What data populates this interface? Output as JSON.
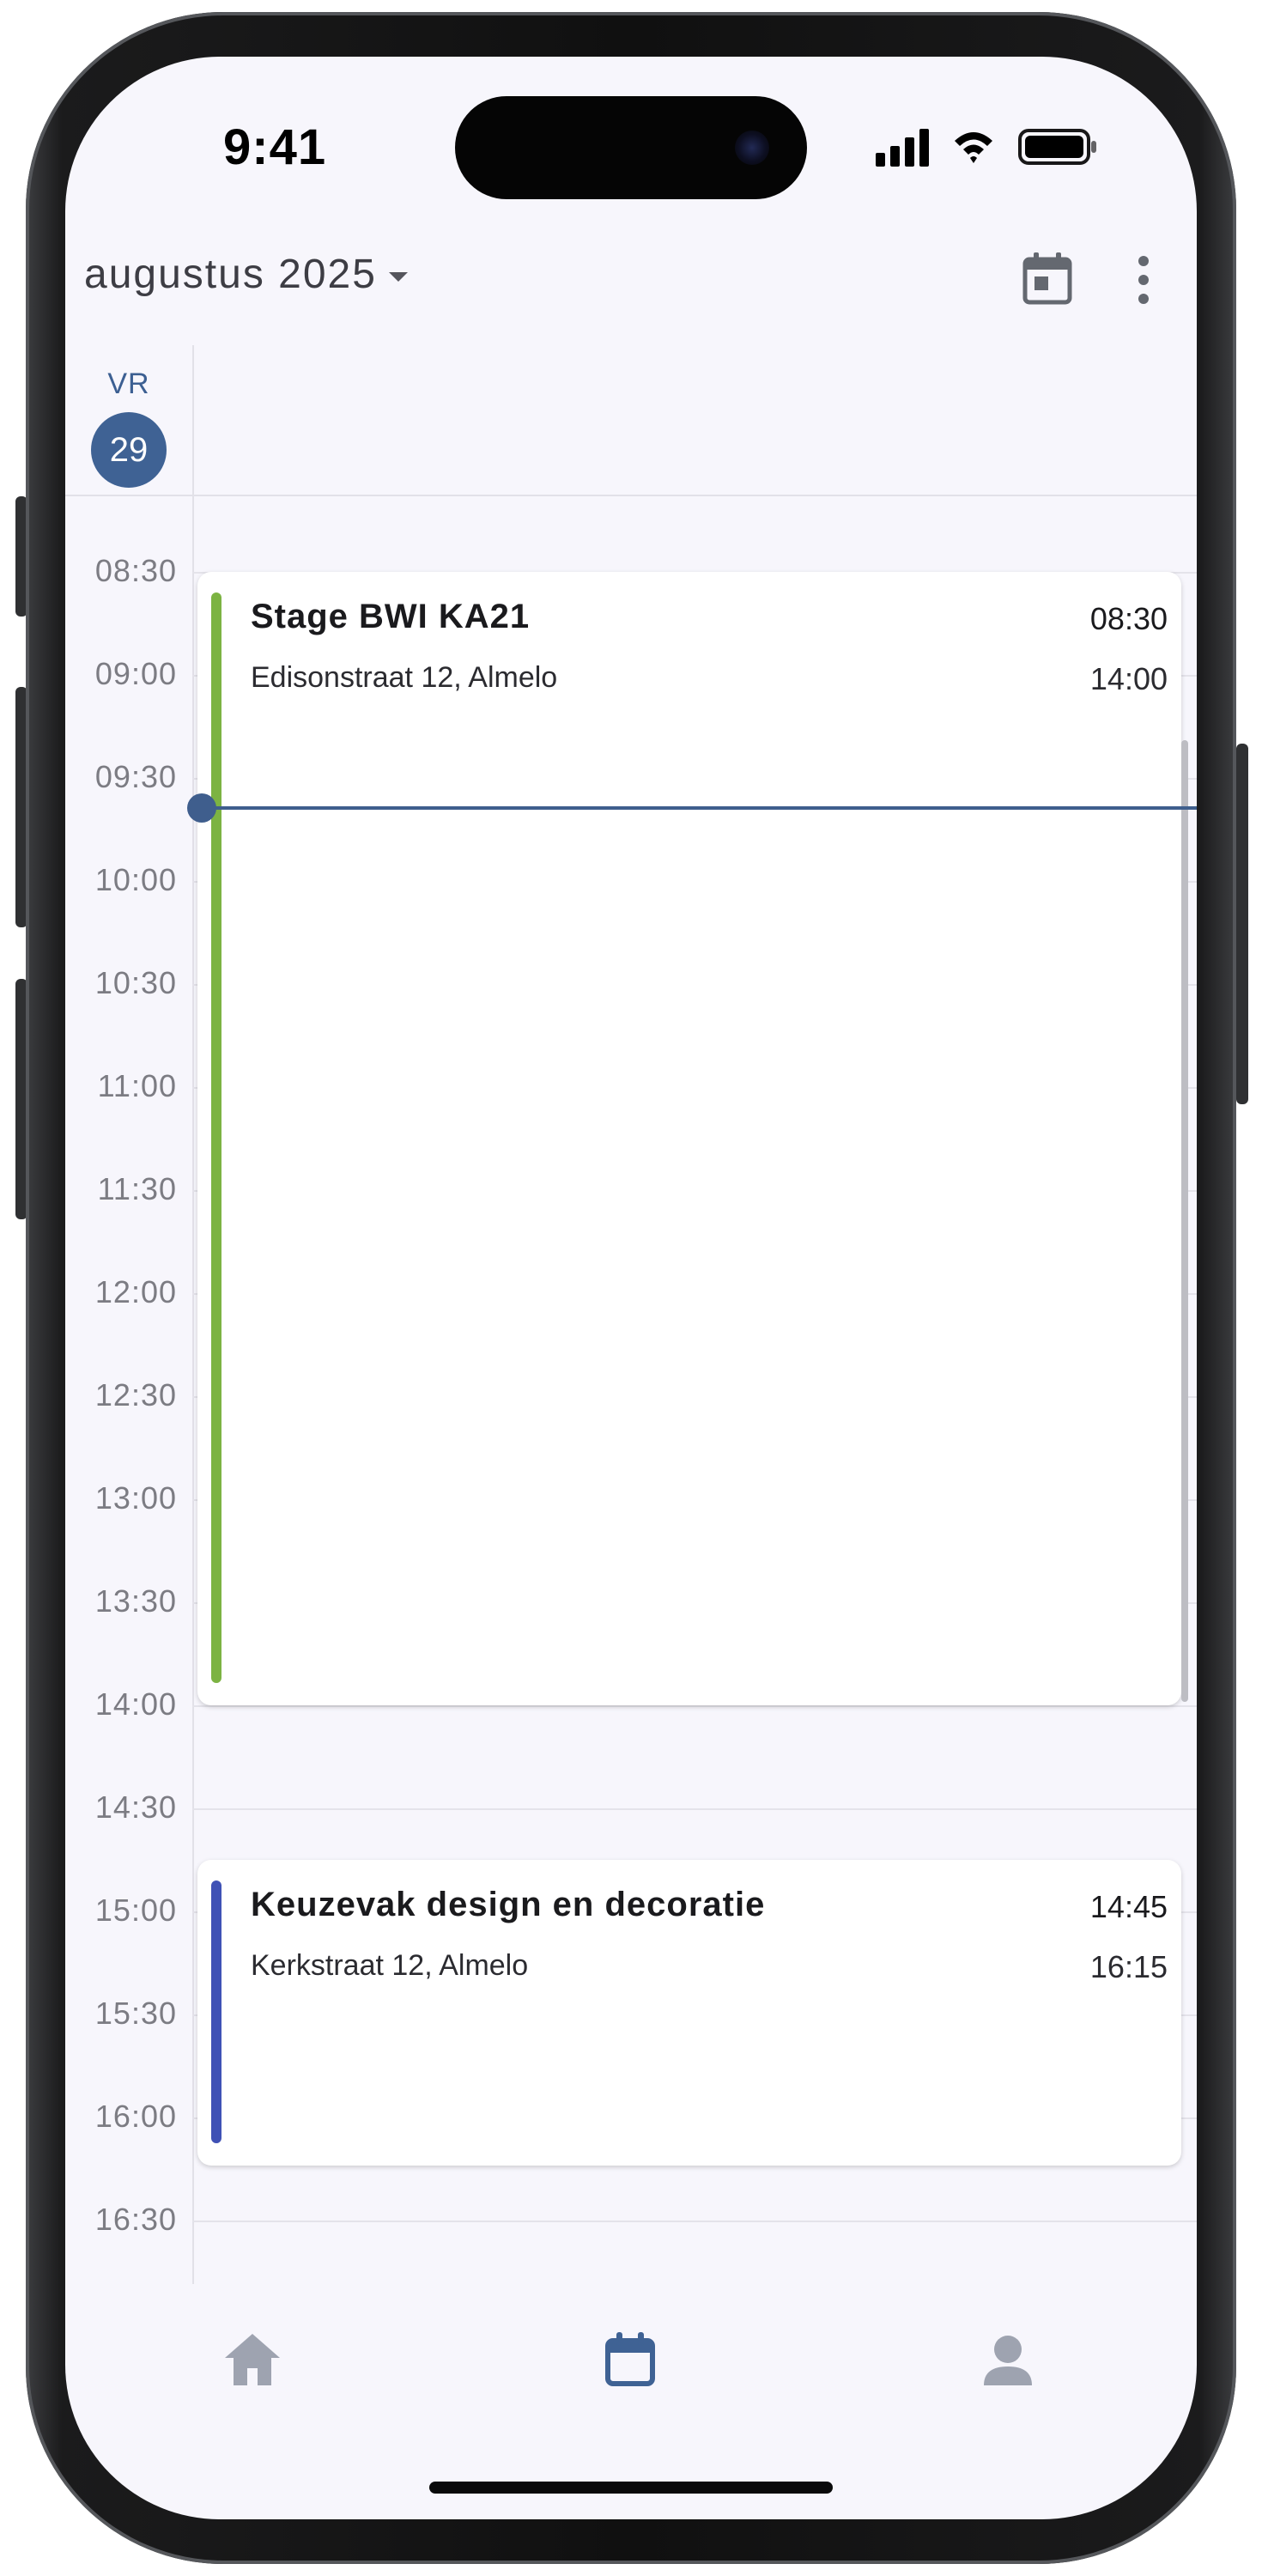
{
  "status_bar": {
    "time": "9:41"
  },
  "header": {
    "month_label": "augustus 2025",
    "icons": [
      "calendar-today-icon",
      "more-vert-icon"
    ]
  },
  "day": {
    "weekday": "VR",
    "date": "29"
  },
  "time_slots": [
    "08:30",
    "09:00",
    "09:30",
    "10:00",
    "10:30",
    "11:00",
    "11:30",
    "12:00",
    "12:30",
    "13:00",
    "13:30",
    "14:00",
    "14:30",
    "15:00",
    "15:30",
    "16:00",
    "16:30"
  ],
  "events": [
    {
      "title": "Stage BWI KA21",
      "location": "Edisonstraat 12, Almelo",
      "start": "08:30",
      "end": "14:00",
      "color": "#7cb342"
    },
    {
      "title": "Keuzevak design en decoratie",
      "location": "Kerkstraat 12, Almelo",
      "start": "14:45",
      "end": "16:15",
      "color": "#3f51b5"
    }
  ],
  "colors": {
    "accent": "#3f6294",
    "background": "#f7f6fc",
    "nav_active": "#3f6294",
    "nav_inactive": "#9ea3b0"
  },
  "bottom_nav": {
    "items": [
      "home-icon",
      "calendar-icon",
      "person-icon"
    ],
    "active": "calendar-icon"
  }
}
